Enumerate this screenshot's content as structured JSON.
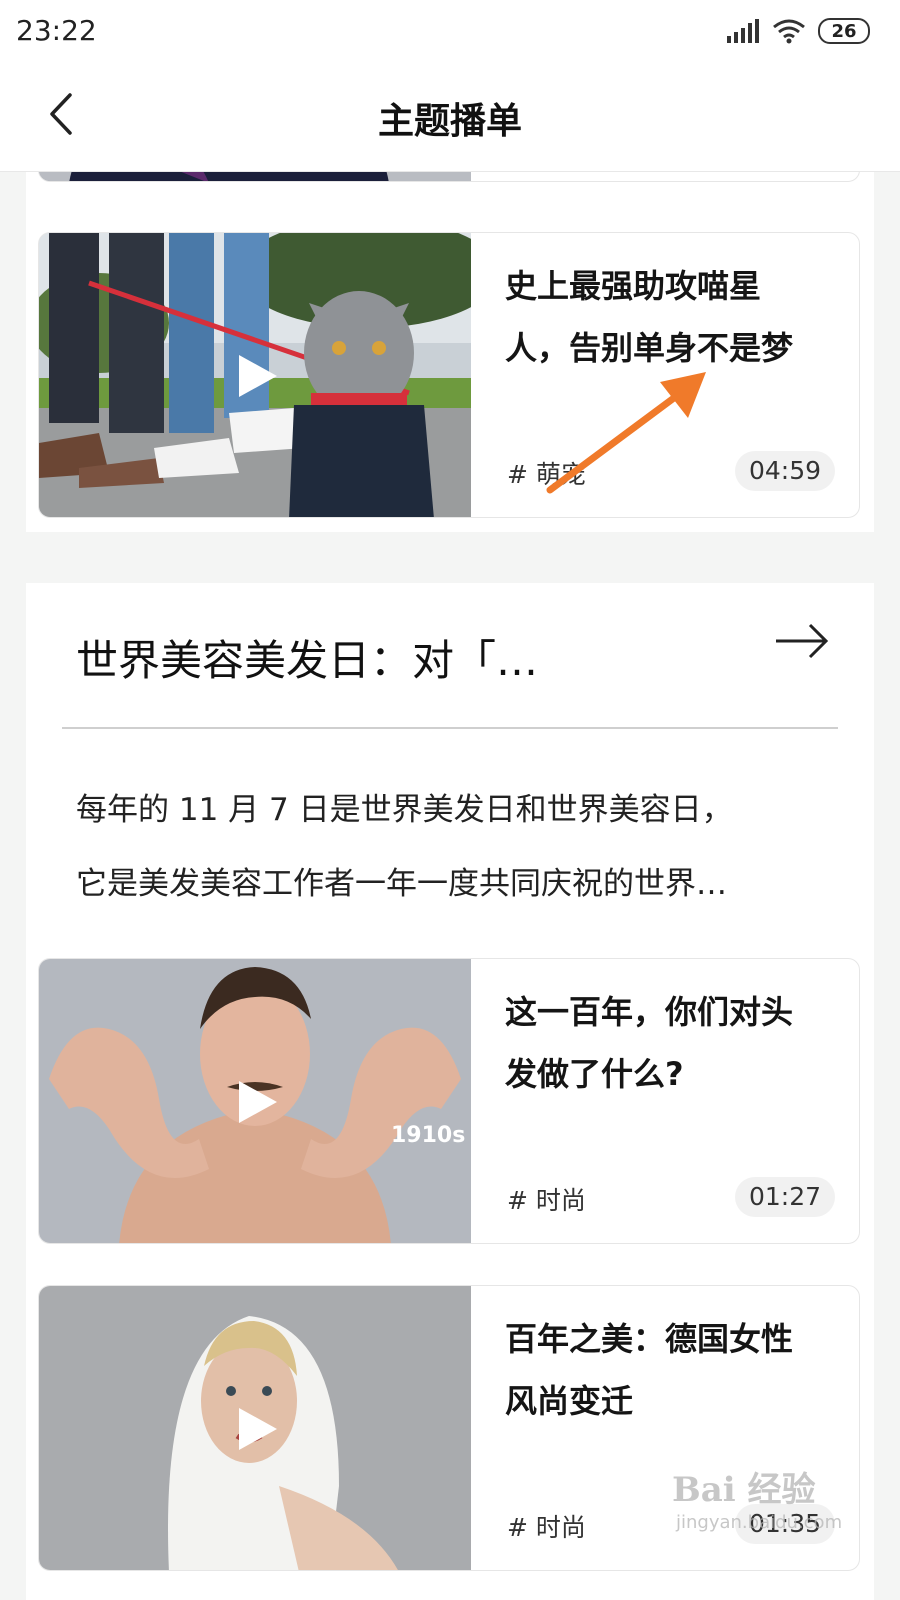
{
  "status_bar": {
    "time": "23:22",
    "battery": "26"
  },
  "header": {
    "title": "主题播单"
  },
  "cards": [
    {
      "title_line1": "史上最强助攻喵星",
      "title_line2": "人，告别单身不是梦",
      "tag": "# 萌宠",
      "duration": "04:59"
    },
    {
      "title_line1": "这一百年，你们对头",
      "title_line2": "发做了什么?",
      "tag": "# 时尚",
      "duration": "01:27",
      "thumb_caption": "1910s"
    },
    {
      "title_line1": "百年之美：德国女性",
      "title_line2": "风尚变迁",
      "tag": "# 时尚",
      "duration": "01:35"
    }
  ],
  "topic": {
    "title": "世界美容美发日：对「…",
    "desc_line1": "每年的 11 月 7 日是世界美发日和世界美容日，",
    "desc_line2": "它是美发美容工作者一年一度共同庆祝的世界…"
  },
  "watermark": {
    "brand": "Bai 经验",
    "url": "jingyan.baidu.com"
  },
  "colors": {
    "annotation_arrow": "#f07a2a",
    "background": "#f4f5f4"
  }
}
